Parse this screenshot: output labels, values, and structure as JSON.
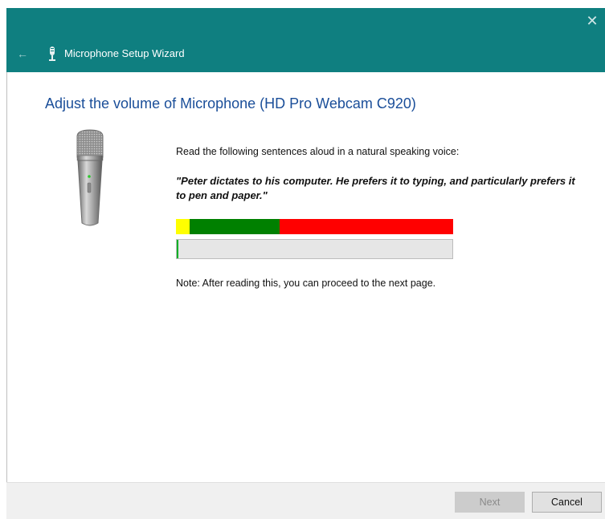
{
  "window": {
    "title": "Microphone Setup Wizard",
    "close_glyph": "✕",
    "back_glyph": "←",
    "accent_color": "#0f7f80"
  },
  "page": {
    "heading": "Adjust the volume of Microphone (HD Pro Webcam C920)",
    "instructions": "Read the following sentences aloud in a natural speaking voice:",
    "quote": "\"Peter dictates to his computer. He prefers it to typing, and particularly prefers it to pen and paper.\"",
    "note": "Note: After reading this, you can proceed to the next page."
  },
  "level_meter": {
    "segments": [
      {
        "color": "#ffff00",
        "fraction": 0.05
      },
      {
        "color": "#008000",
        "fraction": 0.325
      },
      {
        "color": "#ff0000",
        "fraction": 0.625
      }
    ]
  },
  "volume_progress": {
    "fraction": 0.005,
    "color": "#06b025"
  },
  "footer": {
    "next_label": "Next",
    "cancel_label": "Cancel"
  }
}
